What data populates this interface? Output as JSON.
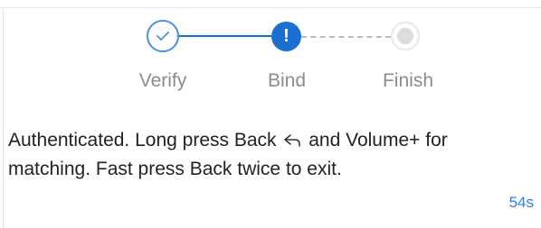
{
  "stepper": {
    "steps": [
      {
        "label": "Verify",
        "state": "done",
        "icon": "check-icon"
      },
      {
        "label": "Bind",
        "state": "current",
        "icon": "exclamation-icon",
        "glyph": "!"
      },
      {
        "label": "Finish",
        "state": "pending",
        "icon": "dot-icon"
      }
    ]
  },
  "message": {
    "part1": "Authenticated. Long press Back",
    "icon": "back-arrow-icon",
    "part2": "and Volume+ for matching. Fast press Back twice to exit."
  },
  "countdown": "54s",
  "colors": {
    "accent": "#1a6fd1",
    "accent_light": "#4a90e2",
    "pending": "#dcdcdc",
    "label": "#8c8c8c",
    "countdown": "#2b7de0"
  }
}
